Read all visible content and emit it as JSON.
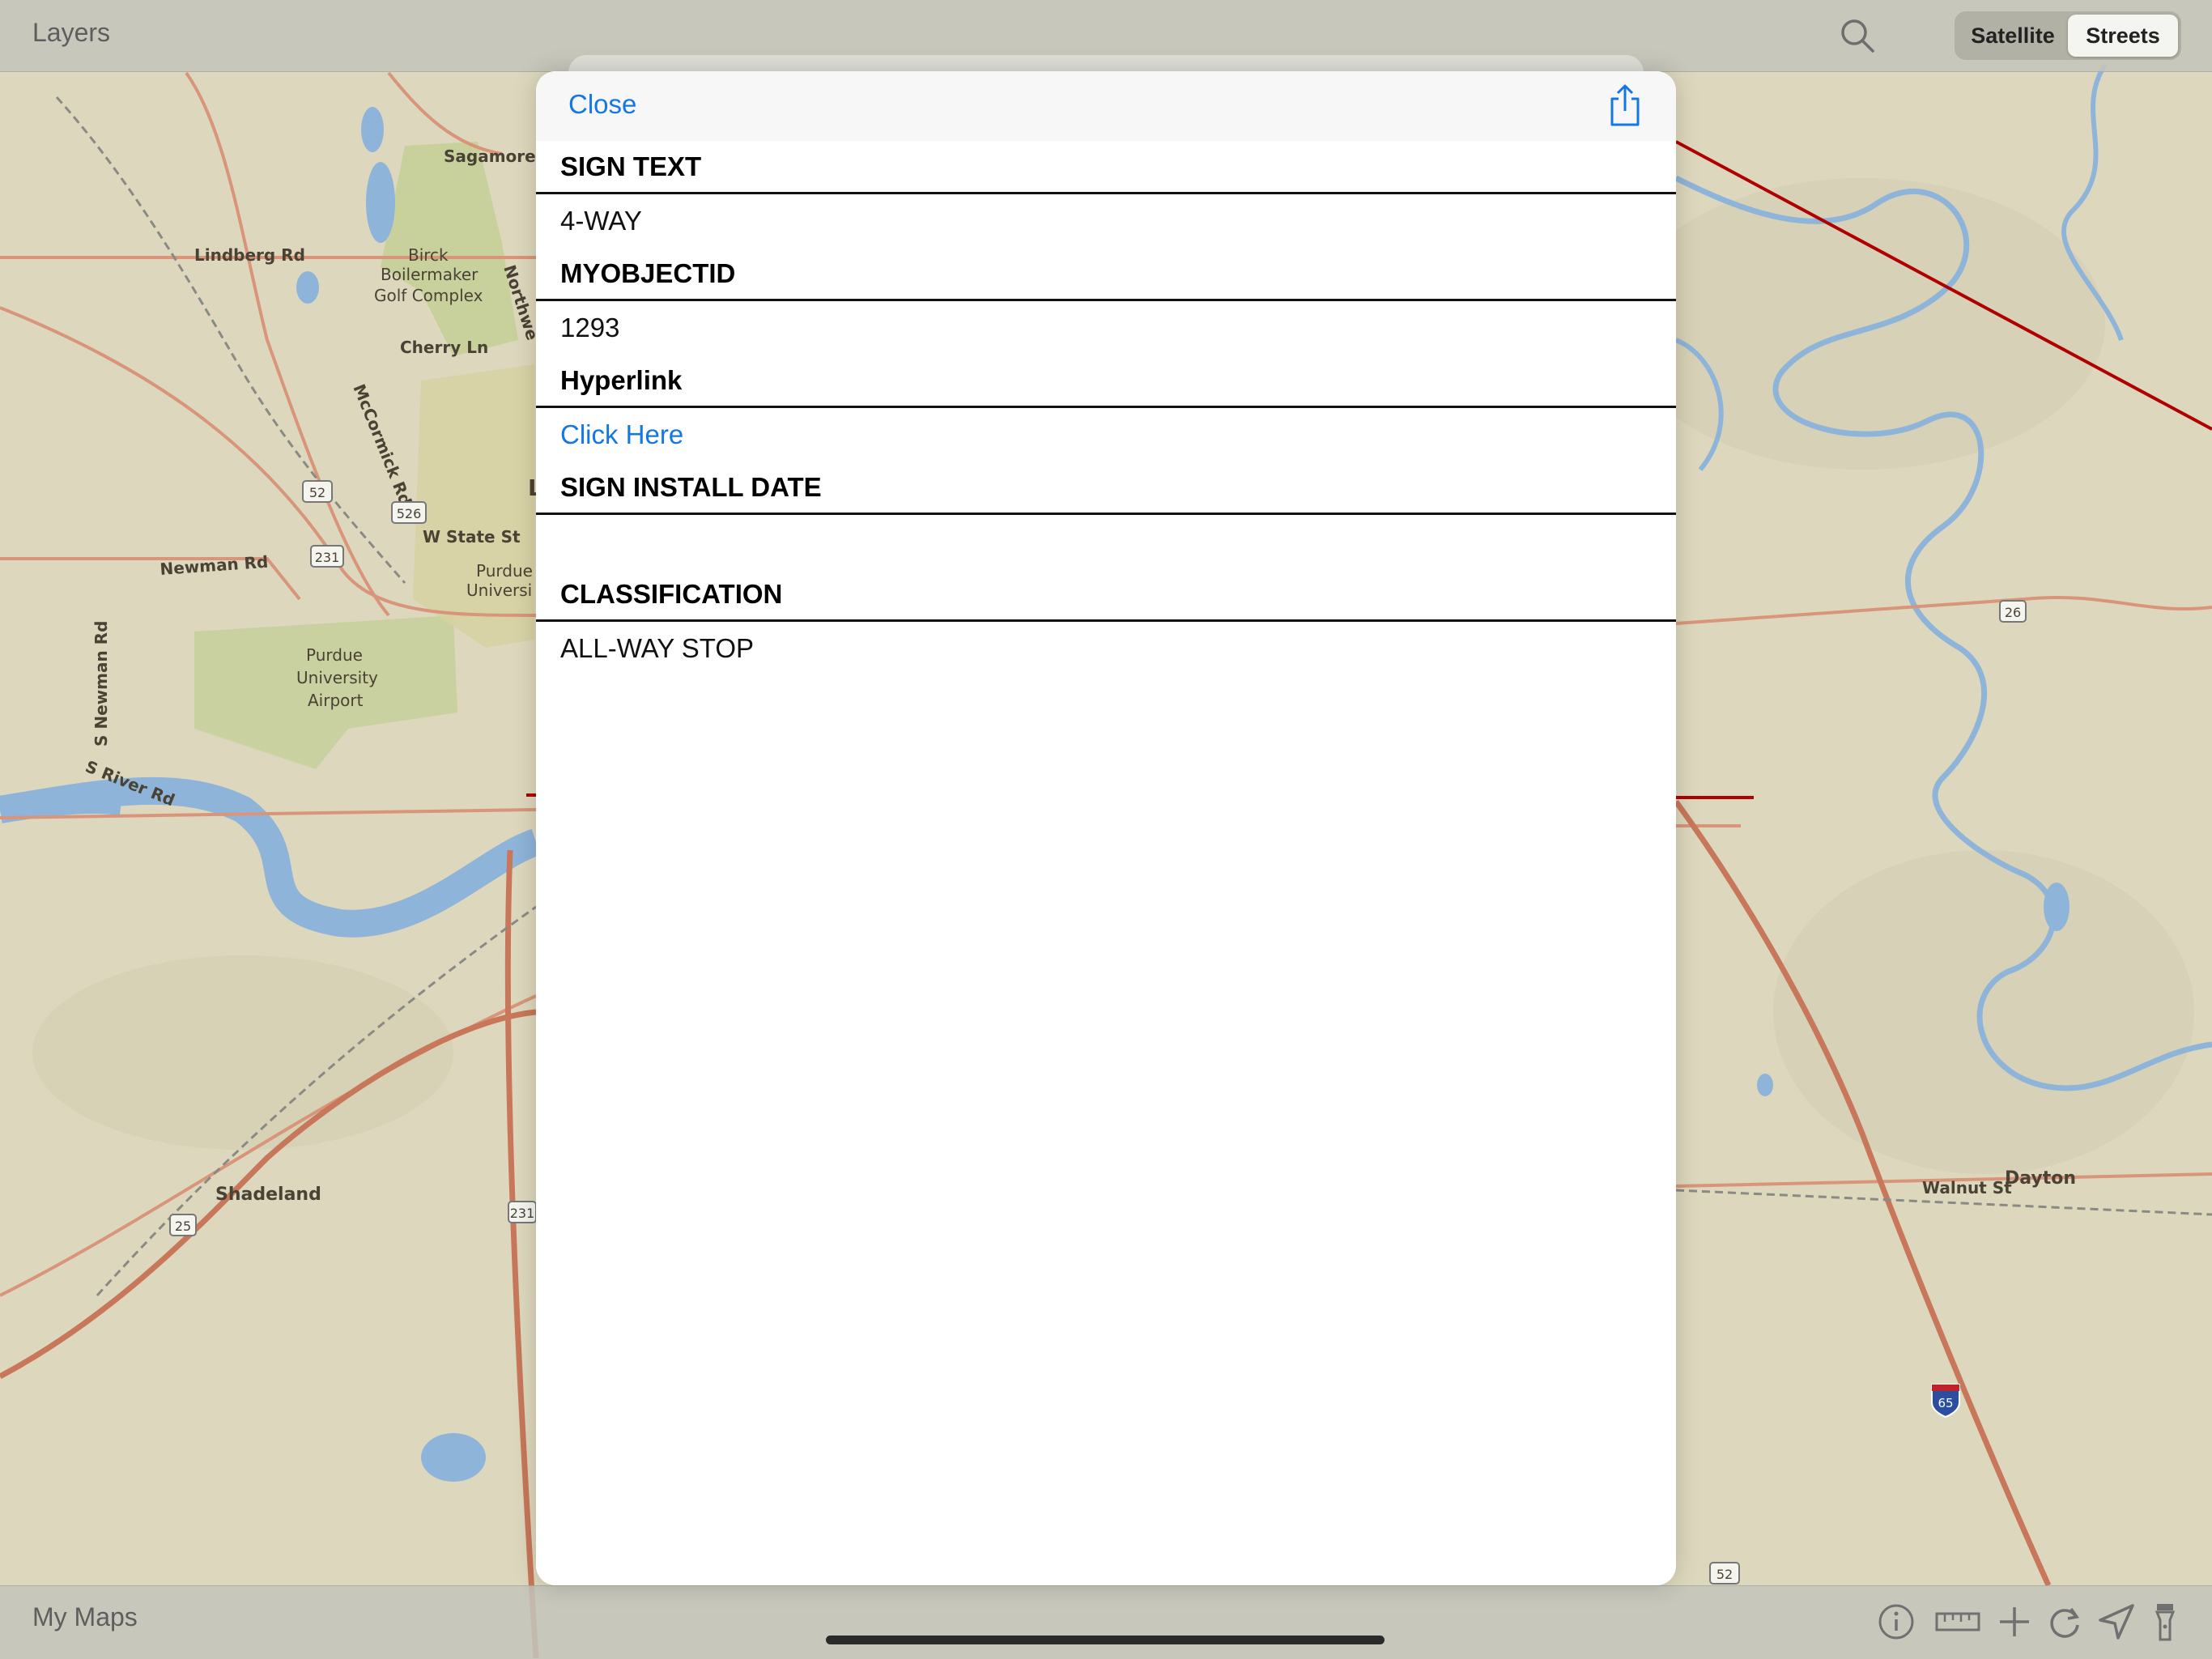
{
  "topbar": {
    "layers_label": "Layers",
    "basemap_options": [
      "Satellite",
      "Streets"
    ],
    "selected_basemap": "Streets"
  },
  "bottombar": {
    "mymaps_label": "My Maps",
    "tools": [
      "info-icon",
      "ruler-icon",
      "add-icon",
      "refresh-icon",
      "location-arrow-icon",
      "flashlight-icon"
    ]
  },
  "modal": {
    "close_label": "Close",
    "fields": [
      {
        "title": "SIGN TEXT",
        "value": "4-WAY"
      },
      {
        "title": "MYOBJECTID",
        "value": "1293"
      },
      {
        "title": "Hyperlink",
        "value": "Click Here"
      },
      {
        "title": "SIGN INSTALL DATE",
        "value": ""
      },
      {
        "title": "CLASSIFICATION",
        "value": "ALL-WAY STOP"
      }
    ]
  },
  "map": {
    "labels": {
      "sagamore": "Sagamore",
      "lindberg": "Lindberg Rd",
      "birck": "Birck",
      "boilermaker": "Boilermaker",
      "golf": "Golf Complex",
      "cherry": "Cherry Ln",
      "mccormick": "McCormick Rd",
      "northwestern": "Northwe",
      "w_state": "W State St",
      "newman": "Newman Rd",
      "purdue_univ": "Purdue",
      "purdue_univ2": "Universi",
      "airport1": "Purdue",
      "airport2": "University",
      "airport3": "Airport",
      "s_newman": "S Newman Rd",
      "s_river": "S River Rd",
      "shadeland": "Shadeland",
      "walnut": "Walnut St",
      "dayton": "Dayton",
      "l_letter": "L"
    },
    "shields": {
      "us52": "52",
      "sr526": "526",
      "us231": "231",
      "us231b": "231",
      "sr25": "25",
      "sr26": "26",
      "i65": "65",
      "us52b": "52"
    },
    "colors": {
      "land": "#ddd8bd",
      "water": "#8fb4d9",
      "road": "#d9957a",
      "highway": "#c8775a",
      "park": "#c5cf98",
      "selection": "#b00000"
    }
  }
}
